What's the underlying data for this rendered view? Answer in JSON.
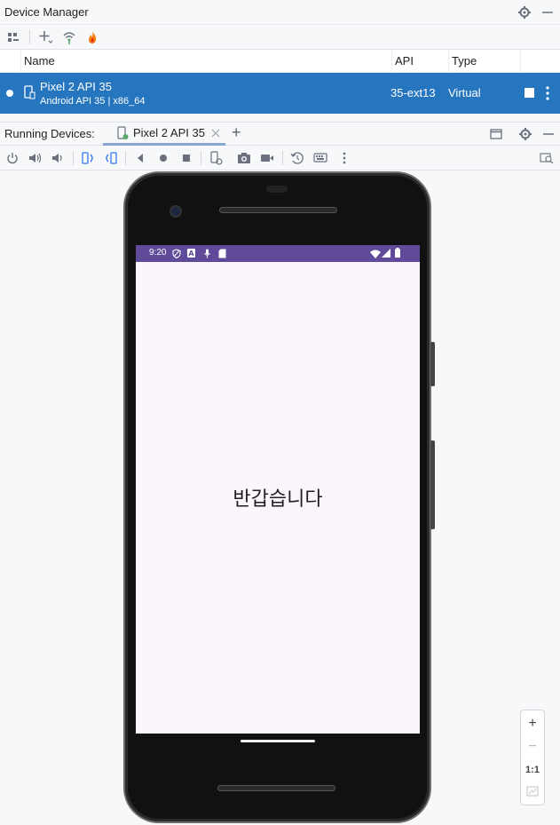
{
  "device_manager": {
    "title": "Device Manager",
    "columns": [
      "Name",
      "API",
      "Type"
    ],
    "device": {
      "name": "Pixel 2 API 35",
      "subtitle": "Android API 35 | x86_64",
      "api": "35-ext13",
      "type": "Virtual"
    }
  },
  "running_devices": {
    "label": "Running Devices:",
    "tab_label": "Pixel 2 API 35",
    "add_tab_label": "+"
  },
  "emulator": {
    "status_time": "9:20",
    "greeting": "반갑습니다"
  },
  "zoom": {
    "zoom_in_label": "+",
    "zoom_out_label": "−",
    "actual_size_label": "1:1"
  },
  "colors": {
    "selection": "#2675bf",
    "status_bar": "#5f4b99",
    "app_background": "#fbf5fc"
  }
}
